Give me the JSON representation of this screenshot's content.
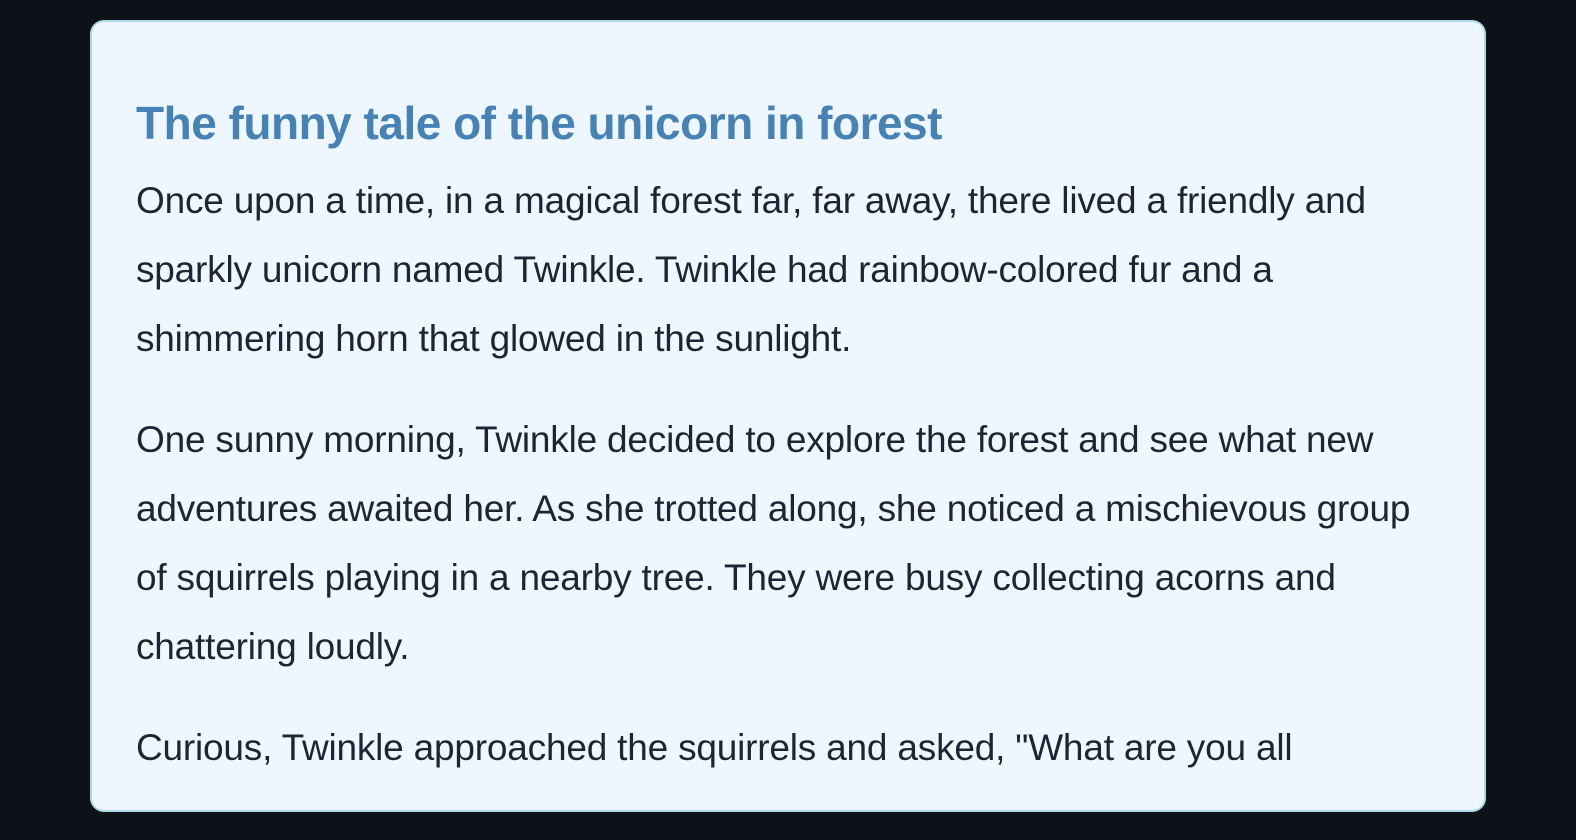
{
  "story": {
    "title": "The funny tale of the unicorn in forest",
    "paragraphs": [
      "Once upon a time, in a magical forest far, far away, there lived a friendly and sparkly unicorn named Twinkle. Twinkle had rainbow-colored fur and a shimmering horn that glowed in the sunlight.",
      "One sunny morning, Twinkle decided to explore the forest and see what new adventures awaited her. As she trotted along, she noticed a mischievous group of squirrels playing in a nearby tree. They were busy collecting acorns and chattering loudly.",
      "Curious, Twinkle approached the squirrels and asked, \"What are you all"
    ]
  },
  "colors": {
    "page_background": "#0e1117",
    "card_background": "#eef7ff",
    "card_border": "#add8e6",
    "title": "#4682b4",
    "body_text": "#1e2433"
  }
}
